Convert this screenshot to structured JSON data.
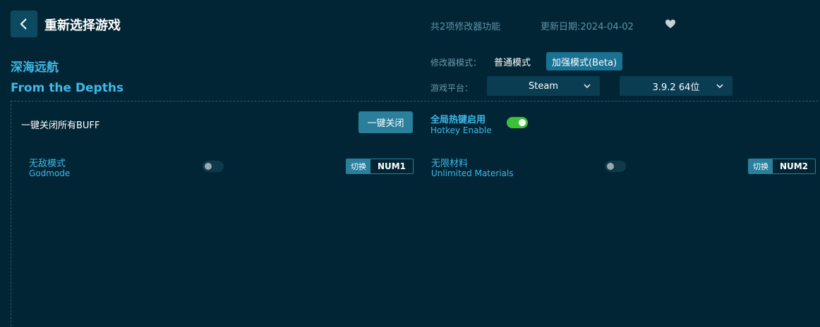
{
  "header": {
    "title": "重新选择游戏",
    "feature_count": "共2项修改器功能",
    "update_date": "更新日期:2024-04-02"
  },
  "game": {
    "name_cn": "深海远航",
    "name_en": "From the Depths"
  },
  "mode": {
    "label": "修改器模式：",
    "normal": "普通模式",
    "enhanced": "加强模式(Beta)",
    "selected": "enhanced"
  },
  "platform": {
    "label": "游戏平台：",
    "value": "Steam",
    "version": "3.9.2 64位"
  },
  "controls": {
    "disable_all_label": "一键关闭所有BUFF",
    "disable_all_button": "一键关闭",
    "hotkey_enable_cn": "全局热键启用",
    "hotkey_enable_en": "Hotkey Enable",
    "hotkey_enabled": true
  },
  "cheats": [
    {
      "name_cn": "无敌模式",
      "name_en": "Godmode",
      "enabled": false,
      "switch_label": "切换",
      "key": "NUM1"
    },
    {
      "name_cn": "无限材料",
      "name_en": "Unlimited Materials",
      "enabled": false,
      "switch_label": "切换",
      "key": "NUM2"
    }
  ],
  "colors": {
    "background": "#022535",
    "accent": "#3fb8e6",
    "button": "#2a7f9c",
    "toggle_on": "#3cc13b"
  },
  "icons": {
    "back": "chevron-left-icon",
    "favorite": "heart-icon",
    "dropdown": "chevron-down-icon"
  }
}
